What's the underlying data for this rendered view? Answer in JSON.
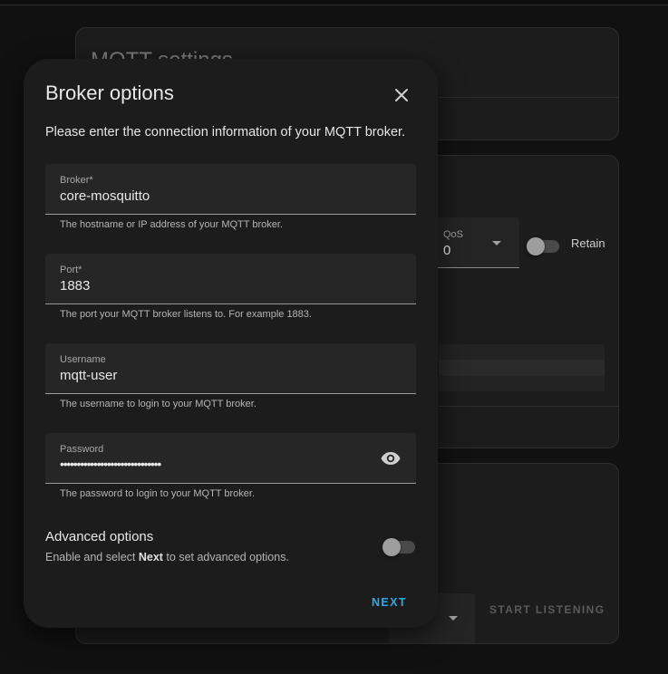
{
  "background": {
    "card_title": "MQTT settings",
    "qos": {
      "label": "QoS",
      "value": "0"
    },
    "retain_label": "Retain",
    "start_listening_label": "START LISTENING"
  },
  "dialog": {
    "title": "Broker options",
    "description": "Please enter the connection information of your MQTT broker.",
    "fields": {
      "broker": {
        "label": "Broker*",
        "value": "core-mosquitto",
        "helper": "The hostname or IP address of your MQTT broker."
      },
      "port": {
        "label": "Port*",
        "value": "1883",
        "helper": "The port your MQTT broker listens to. For example 1883."
      },
      "username": {
        "label": "Username",
        "value": "mqtt-user",
        "helper": "The username to login to your MQTT broker."
      },
      "password": {
        "label": "Password",
        "value": "••••••••••••••••••••••••••••••",
        "helper": "The password to login to your MQTT broker."
      }
    },
    "advanced": {
      "title": "Advanced options",
      "desc_before": "Enable and select ",
      "desc_bold": "Next",
      "desc_after": " to set advanced options.",
      "enabled": false
    },
    "next_label": "NEXT"
  },
  "colors": {
    "accent": "#2ea8e6",
    "surface": "#1c1c1c",
    "field": "#262626"
  }
}
